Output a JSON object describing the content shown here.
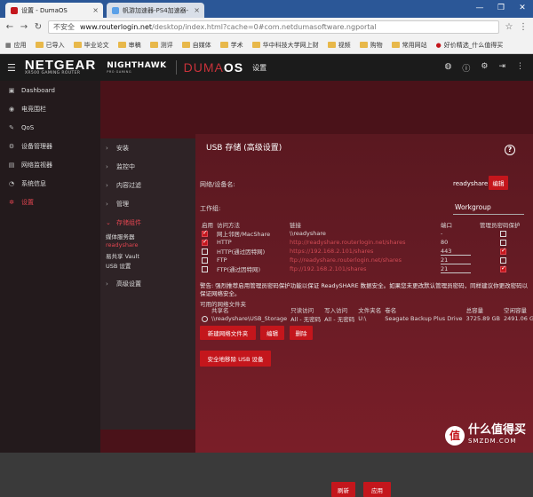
{
  "browser": {
    "tabs": [
      {
        "title": "设置 - DumaOS",
        "close": "×"
      },
      {
        "title": "帆游加速器-PS4加速器-",
        "close": "×"
      }
    ],
    "window_controls": [
      "—",
      "❐",
      "✕"
    ],
    "security_label": "不安全",
    "url_host": "www.routerlogin.net",
    "url_path": "/desktop/index.html?cache=0#com.netdumasoftware.ngportal",
    "bookmarks": [
      "应用",
      "已导入",
      "毕业论文",
      "审稿",
      "测评",
      "自媒体",
      "学术",
      "华中科技大学网上财",
      "视频",
      "购物",
      "常用网站",
      "好价精选_什么值得买"
    ]
  },
  "header": {
    "brand": "NETGEAR",
    "brand_sub": "XR500 GAMING ROUTER",
    "nighthawk": "NIGHTHAWK",
    "nighthawk_sub": "PRO GAMING",
    "duma_prefix": "DUMA",
    "duma_suffix": "OS",
    "section": "设置"
  },
  "leftnav": {
    "items": [
      {
        "label": "Dashboard",
        "icon": "dashboard-icon"
      },
      {
        "label": "电竞围栏",
        "icon": "geofence-icon"
      },
      {
        "label": "QoS",
        "icon": "qos-icon"
      },
      {
        "label": "设备管理器",
        "icon": "device-manager-icon"
      },
      {
        "label": "网络监视器",
        "icon": "network-monitor-icon"
      },
      {
        "label": "系统信息",
        "icon": "system-info-icon"
      },
      {
        "label": "设置",
        "icon": "settings-gear-icon"
      }
    ]
  },
  "subnav": {
    "items": [
      "安装",
      "监控中",
      "内容过滤",
      "管理",
      "存储组件",
      "高级设置"
    ],
    "open_items": [
      "媒体服务器",
      "readyshare",
      "易共享 Vault",
      "USB 设置"
    ]
  },
  "main": {
    "title": "USB 存储 (高级设置)",
    "network_device_label": "网络/设备名:",
    "device_name": "readyshare",
    "edit_label": "编辑",
    "workgroup_label": "工作组:",
    "workgroup_value": "Workgroup",
    "access_headers": [
      "启用",
      "访问方法",
      "链接",
      "端口",
      "管理员密码保护"
    ],
    "access_rows": [
      {
        "enabled": true,
        "method": "网上邻居/MacShare",
        "link": "\\\\readyshare",
        "link_red": false,
        "port": "-",
        "protect": false
      },
      {
        "enabled": true,
        "method": "HTTP",
        "link": "http://readyshare.routerlogin.net/shares",
        "link_red": true,
        "port": "80",
        "protect": false
      },
      {
        "enabled": false,
        "method": "HTTP(通过因特网)",
        "link": "https://192.168.2.101/shares",
        "link_red": true,
        "port": "443",
        "protect": true
      },
      {
        "enabled": false,
        "method": "FTP",
        "link": "ftp://readyshare.routerlogin.net/shares",
        "link_red": true,
        "port": "21",
        "protect": false
      },
      {
        "enabled": false,
        "method": "FTP(通过因特网)",
        "link": "ftp://192.168.2.101/shares",
        "link_red": true,
        "port": "21",
        "protect": true
      }
    ],
    "warning": "警告: 强烈推荐启用管理员密码保护功能以保证 ReadySHARE 数据安全。如果您未更改默认管理员密码，同样建议你更改密码以保证网络安全。",
    "shared_folders_label": "可用的网络文件夹",
    "share_headers": [
      "共享名",
      "只读访问",
      "写入访问",
      "文件夹名",
      "卷名",
      "总容量",
      "空闲容量"
    ],
    "share_rows": [
      {
        "name": "\\\\readyshare\\USB_Storage",
        "read": "All - 无密码",
        "write": "All - 无密码",
        "folder": "U:\\",
        "volume": "Seagate Backup Plus Drive",
        "total": "3725.89 GB",
        "free": "2491.06 GB"
      }
    ],
    "btn_create": "新建网络文件夹",
    "btn_edit": "编辑",
    "btn_delete": "删除",
    "btn_safe_remove": "安全地移除 USB 设备",
    "btn_refresh": "刷新",
    "btn_apply": "应用"
  },
  "watermark": {
    "logo": "值",
    "text": "什么值得买",
    "sub": "SMZDM.COM"
  }
}
